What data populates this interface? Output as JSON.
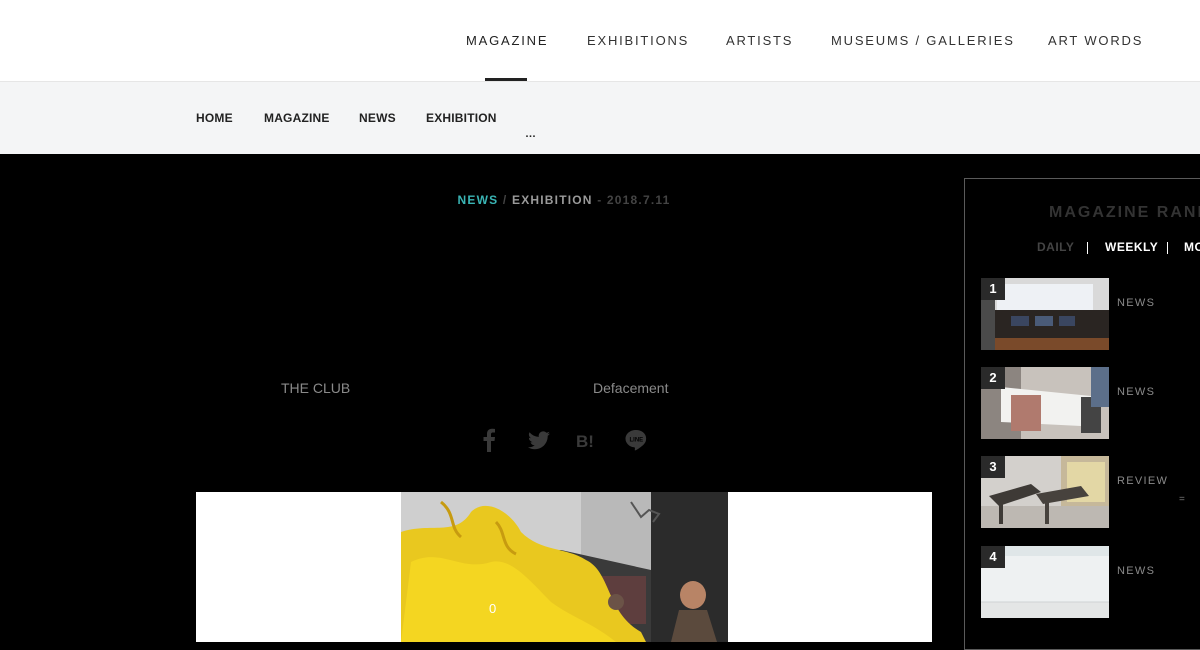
{
  "header": {
    "nav": [
      "MAGAZINE",
      "EXHIBITIONS",
      "ARTISTS",
      "MUSEUMS / GALLERIES",
      "ART WORDS"
    ],
    "active": "MAGAZINE"
  },
  "breadcrumb": {
    "items": [
      "HOME",
      "MAGAZINE",
      "NEWS",
      "EXHIBITION"
    ],
    "ellipsis": "…"
  },
  "article": {
    "category": "NEWS",
    "separator": "/",
    "subcategory": "EXHIBITION",
    "date": "- 2018.7.11",
    "tags": [
      "THE CLUB",
      "Defacement"
    ],
    "share_icons": [
      "facebook-icon",
      "twitter-icon",
      "hatena-bookmark-icon",
      "line-icon"
    ],
    "hero_overlay": "0"
  },
  "ranking": {
    "title": "MAGAZINE RANKING",
    "tabs": [
      "DAILY",
      "WEEKLY",
      "MONTHLY"
    ],
    "active_tab": "WEEKLY",
    "items": [
      {
        "rank": "1",
        "category": "NEWS"
      },
      {
        "rank": "2",
        "category": "NEWS"
      },
      {
        "rank": "3",
        "category": "REVIEW",
        "mark": "="
      },
      {
        "rank": "4",
        "category": "NEWS"
      }
    ]
  },
  "colors": {
    "accent": "#3ab5b5",
    "background": "#000000",
    "header": "#ffffff",
    "crumbbar": "#f4f5f6"
  }
}
